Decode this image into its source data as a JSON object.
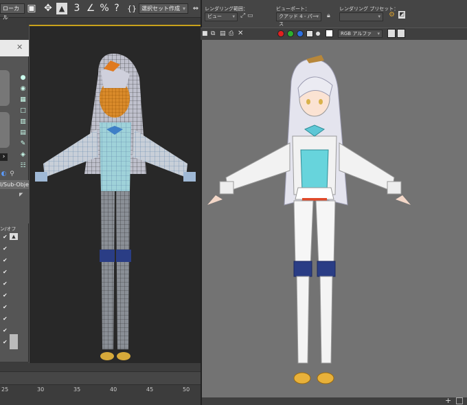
{
  "left_toolbar": {
    "coord_dropdown": "ローカル",
    "selection_set_dropdown": "選択セット作成"
  },
  "command_panel": {
    "subobject_label": "I/Sub-Object",
    "onoff_label": "ン/オフ"
  },
  "timeline": {
    "ticks": [
      "25",
      "30",
      "35",
      "40",
      "45",
      "50"
    ]
  },
  "render_window": {
    "render_area_label": "レンダリング範囲：",
    "render_area_value": "ビュー",
    "viewport_label": "ビューポート：",
    "viewport_value": "クアッド 4 - パース",
    "preset_label": "レンダリング プリセット：",
    "preset_value": "",
    "channel_value": "RGB アルファ",
    "channel_colors": [
      "#e02020",
      "#2db02d",
      "#2d6fe0",
      "#ffffff"
    ]
  },
  "colors": {
    "accent_frame": "#c9a21b",
    "render_bg": "#737373",
    "viewport_bg": "#282828"
  }
}
